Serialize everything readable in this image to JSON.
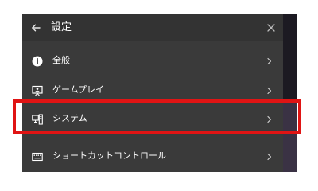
{
  "panel": {
    "title": "設定",
    "back_icon": "back-arrow-icon",
    "close_icon": "close-icon"
  },
  "menu": {
    "items": [
      {
        "label": "全般",
        "icon": "info-icon"
      },
      {
        "label": "ゲームプレイ",
        "icon": "gameplay-icon"
      },
      {
        "label": "システム",
        "icon": "system-icon"
      },
      {
        "label": "ショートカットコントロール",
        "icon": "keyboard-icon"
      }
    ],
    "chevron_icon": "chevron-right-icon"
  },
  "annotation": {
    "highlighted_item": "システム",
    "color": "#e01414"
  }
}
